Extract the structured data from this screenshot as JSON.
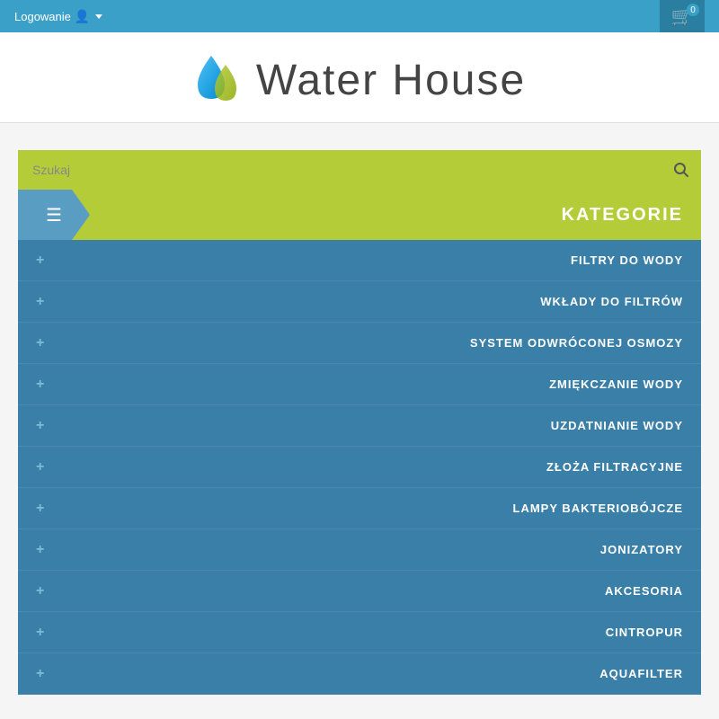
{
  "topbar": {
    "login_label": "Logowanie",
    "cart_count": "0"
  },
  "header": {
    "logo_text": "Water House"
  },
  "search": {
    "placeholder": "Szukaj"
  },
  "categories": {
    "title": "KATEGORIE",
    "items": [
      {
        "label": "FILTRY DO WODY"
      },
      {
        "label": "WKŁADY DO FILTRÓW"
      },
      {
        "label": "SYSTEM ODWRÓCONEJ OSMOZY"
      },
      {
        "label": "ZMIĘKCZANIE WODY"
      },
      {
        "label": "UZDATNIANIE WODY"
      },
      {
        "label": "ZŁOŻA FILTRACYJNE"
      },
      {
        "label": "LAMPY BAKTERIOBÓJCZE"
      },
      {
        "label": "JONIZATORY"
      },
      {
        "label": "AKCESORIA"
      },
      {
        "label": "CINTROPUR"
      },
      {
        "label": "AQUAFILTER"
      }
    ]
  }
}
